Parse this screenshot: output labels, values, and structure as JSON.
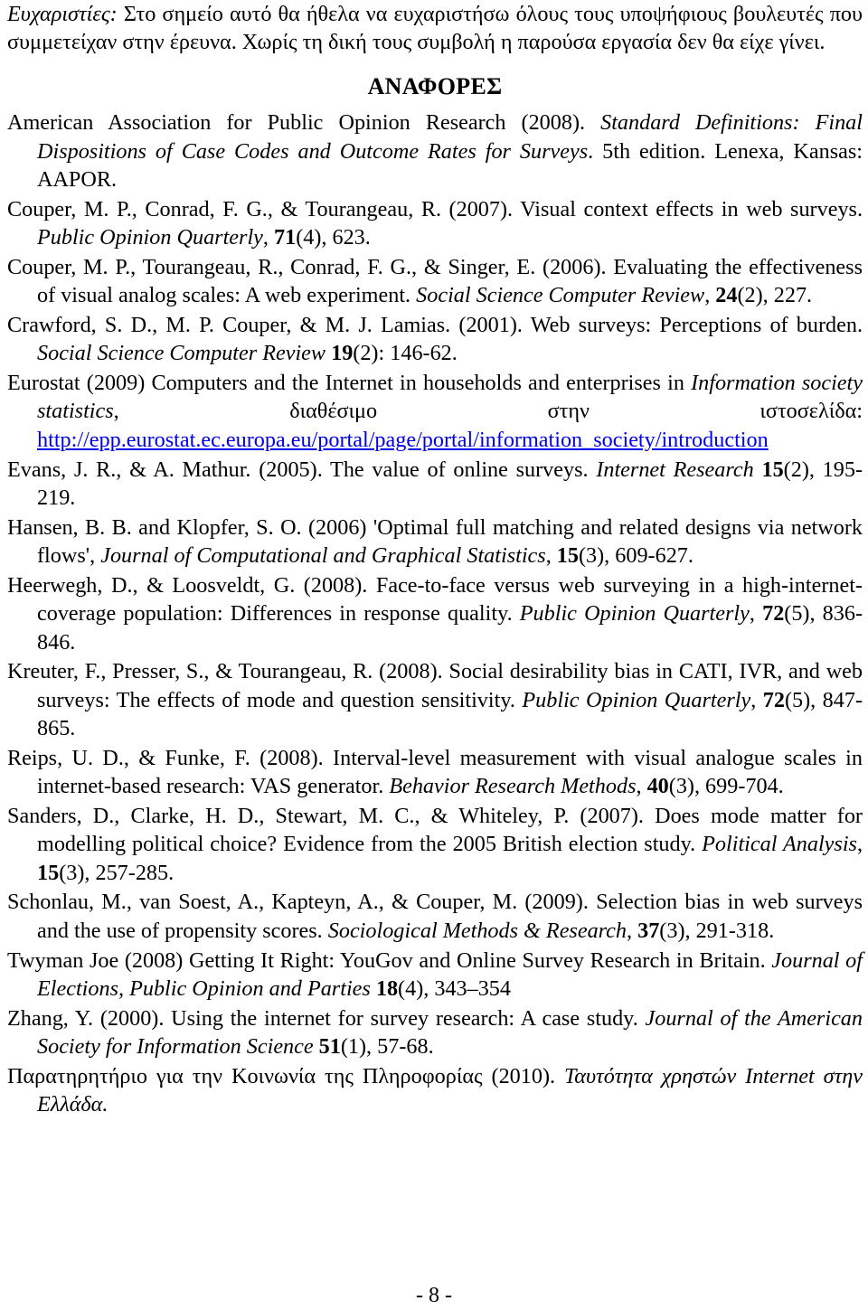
{
  "acknowledgement": {
    "label": "Ευχαριστίες:",
    "text": " Στο σημείο αυτό θα ήθελα να ευχαριστήσω όλους τους υποψήφιους βουλευτές που συμμετείχαν στην έρευνα. Χωρίς τη δική τους συμβολή η παρούσα εργασία δεν θα είχε γίνει."
  },
  "references_heading": "ΑΝΑΦΟΡΕΣ",
  "references": [
    {
      "segments": [
        {
          "t": "American Association for Public Opinion Research (2008). ",
          "s": "n"
        },
        {
          "t": "Standard Definitions: Final Dispositions of Case Codes and Outcome Rates for Surveys",
          "s": "i"
        },
        {
          "t": ". 5th edition. Lenexa, Kansas: AAPOR.",
          "s": "n"
        }
      ]
    },
    {
      "segments": [
        {
          "t": "Couper, M. P., Conrad, F. G., & Tourangeau, R. (2007). Visual context effects in web surveys. ",
          "s": "n"
        },
        {
          "t": "Public Opinion Quarterly",
          "s": "i"
        },
        {
          "t": ", ",
          "s": "n"
        },
        {
          "t": "71",
          "s": "b"
        },
        {
          "t": "(4), 623.",
          "s": "n"
        }
      ]
    },
    {
      "segments": [
        {
          "t": "Couper, M. P., Tourangeau, R., Conrad, F. G., & Singer, E. (2006). Evaluating the effectiveness of visual analog scales: A web experiment. ",
          "s": "n"
        },
        {
          "t": "Social Science Computer Review",
          "s": "i"
        },
        {
          "t": ", ",
          "s": "n"
        },
        {
          "t": "24",
          "s": "b"
        },
        {
          "t": "(2), 227.",
          "s": "n"
        }
      ]
    },
    {
      "segments": [
        {
          "t": "Crawford, S. D., M. P. Couper, & M. J. Lamias. (2001). Web surveys: Perceptions of burden. ",
          "s": "n"
        },
        {
          "t": "Social Science Computer Review",
          "s": "i"
        },
        {
          "t": " ",
          "s": "n"
        },
        {
          "t": "19",
          "s": "b"
        },
        {
          "t": "(2): 146-62.",
          "s": "n"
        }
      ]
    },
    {
      "segments": [
        {
          "t": "Eurostat (2009) Computers and the Internet in households and enterprises in ",
          "s": "n"
        },
        {
          "t": "Information society statistics",
          "s": "i"
        },
        {
          "t": ", διαθέσιμο στην ιστοσελίδα: ",
          "s": "n"
        },
        {
          "t": "http://epp.eurostat.ec.europa.eu/portal/page/portal/information_society/introduction",
          "s": "link"
        }
      ]
    },
    {
      "segments": [
        {
          "t": "Evans, J. R., & A. Mathur. (2005). The value of online surveys. ",
          "s": "n"
        },
        {
          "t": "Internet Research",
          "s": "i"
        },
        {
          "t": " ",
          "s": "n"
        },
        {
          "t": "15",
          "s": "b"
        },
        {
          "t": "(2), 195-219.",
          "s": "n"
        }
      ]
    },
    {
      "segments": [
        {
          "t": "Hansen, B. B. and Klopfer, S. O. (2006) 'Optimal full matching and related designs via network flows', ",
          "s": "n"
        },
        {
          "t": "Journal of Computational and Graphical Statistics",
          "s": "i"
        },
        {
          "t": ", ",
          "s": "n"
        },
        {
          "t": "15",
          "s": "b"
        },
        {
          "t": "(3), 609-627.",
          "s": "n"
        }
      ]
    },
    {
      "segments": [
        {
          "t": "Heerwegh, D., & Loosveldt, G. (2008). Face-to-face versus web surveying in a high-internet-coverage population: Differences in response quality. ",
          "s": "n"
        },
        {
          "t": "Public Opinion Quarterly",
          "s": "i"
        },
        {
          "t": ", ",
          "s": "n"
        },
        {
          "t": "72",
          "s": "b"
        },
        {
          "t": "(5), 836-846.",
          "s": "n"
        }
      ]
    },
    {
      "segments": [
        {
          "t": "Kreuter, F., Presser, S., & Tourangeau, R. (2008). Social desirability bias in CATI, IVR, and web surveys: The effects of mode and question sensitivity. ",
          "s": "n"
        },
        {
          "t": "Public Opinion Quarterly",
          "s": "i"
        },
        {
          "t": ", ",
          "s": "n"
        },
        {
          "t": "72",
          "s": "b"
        },
        {
          "t": "(5), 847-865.",
          "s": "n"
        }
      ]
    },
    {
      "segments": [
        {
          "t": "Reips, U. D., & Funke, F. (2008). Interval-level measurement with visual analogue scales in internet-based research: VAS generator. ",
          "s": "n"
        },
        {
          "t": "Behavior Research Methods",
          "s": "i"
        },
        {
          "t": ", ",
          "s": "n"
        },
        {
          "t": "40",
          "s": "b"
        },
        {
          "t": "(3), 699-704.",
          "s": "n"
        }
      ]
    },
    {
      "segments": [
        {
          "t": "Sanders, D., Clarke, H. D., Stewart, M. C., & Whiteley, P. (2007). Does mode matter for modelling political choice? Evidence from the 2005 British election study. ",
          "s": "n"
        },
        {
          "t": "Political Analysis",
          "s": "i"
        },
        {
          "t": ", ",
          "s": "n"
        },
        {
          "t": "15",
          "s": "b"
        },
        {
          "t": "(3), 257-285.",
          "s": "n"
        }
      ]
    },
    {
      "segments": [
        {
          "t": "Schonlau, M., van Soest, A., Kapteyn, A., & Couper, M. (2009). Selection bias in web surveys and the use of propensity scores. ",
          "s": "n"
        },
        {
          "t": "Sociological Methods & Research",
          "s": "i"
        },
        {
          "t": ", ",
          "s": "n"
        },
        {
          "t": "37",
          "s": "b"
        },
        {
          "t": "(3), 291-318.",
          "s": "n"
        }
      ]
    },
    {
      "segments": [
        {
          "t": "Twyman Joe (2008) Getting It Right: YouGov and Online Survey Research in Britain. ",
          "s": "n"
        },
        {
          "t": "Journal of Elections, Public Opinion and Parties",
          "s": "i"
        },
        {
          "t": " ",
          "s": "n"
        },
        {
          "t": "18",
          "s": "b"
        },
        {
          "t": "(4), 343–354",
          "s": "n"
        }
      ]
    },
    {
      "segments": [
        {
          "t": "Zhang, Y. (2000). Using the internet for survey research: A case study. ",
          "s": "n"
        },
        {
          "t": "Journal of the American Society for Information Science",
          "s": "i"
        },
        {
          "t": " ",
          "s": "n"
        },
        {
          "t": "51",
          "s": "b"
        },
        {
          "t": "(1), 57-68.",
          "s": "n"
        }
      ]
    },
    {
      "segments": [
        {
          "t": "Παρατηρητήριο για την Κοινωνία της Πληροφορίας (2010). ",
          "s": "n"
        },
        {
          "t": "Ταυτότητα χρηστών Internet στην Ελλάδα.",
          "s": "i"
        }
      ]
    }
  ],
  "page_number": "- 8 -"
}
